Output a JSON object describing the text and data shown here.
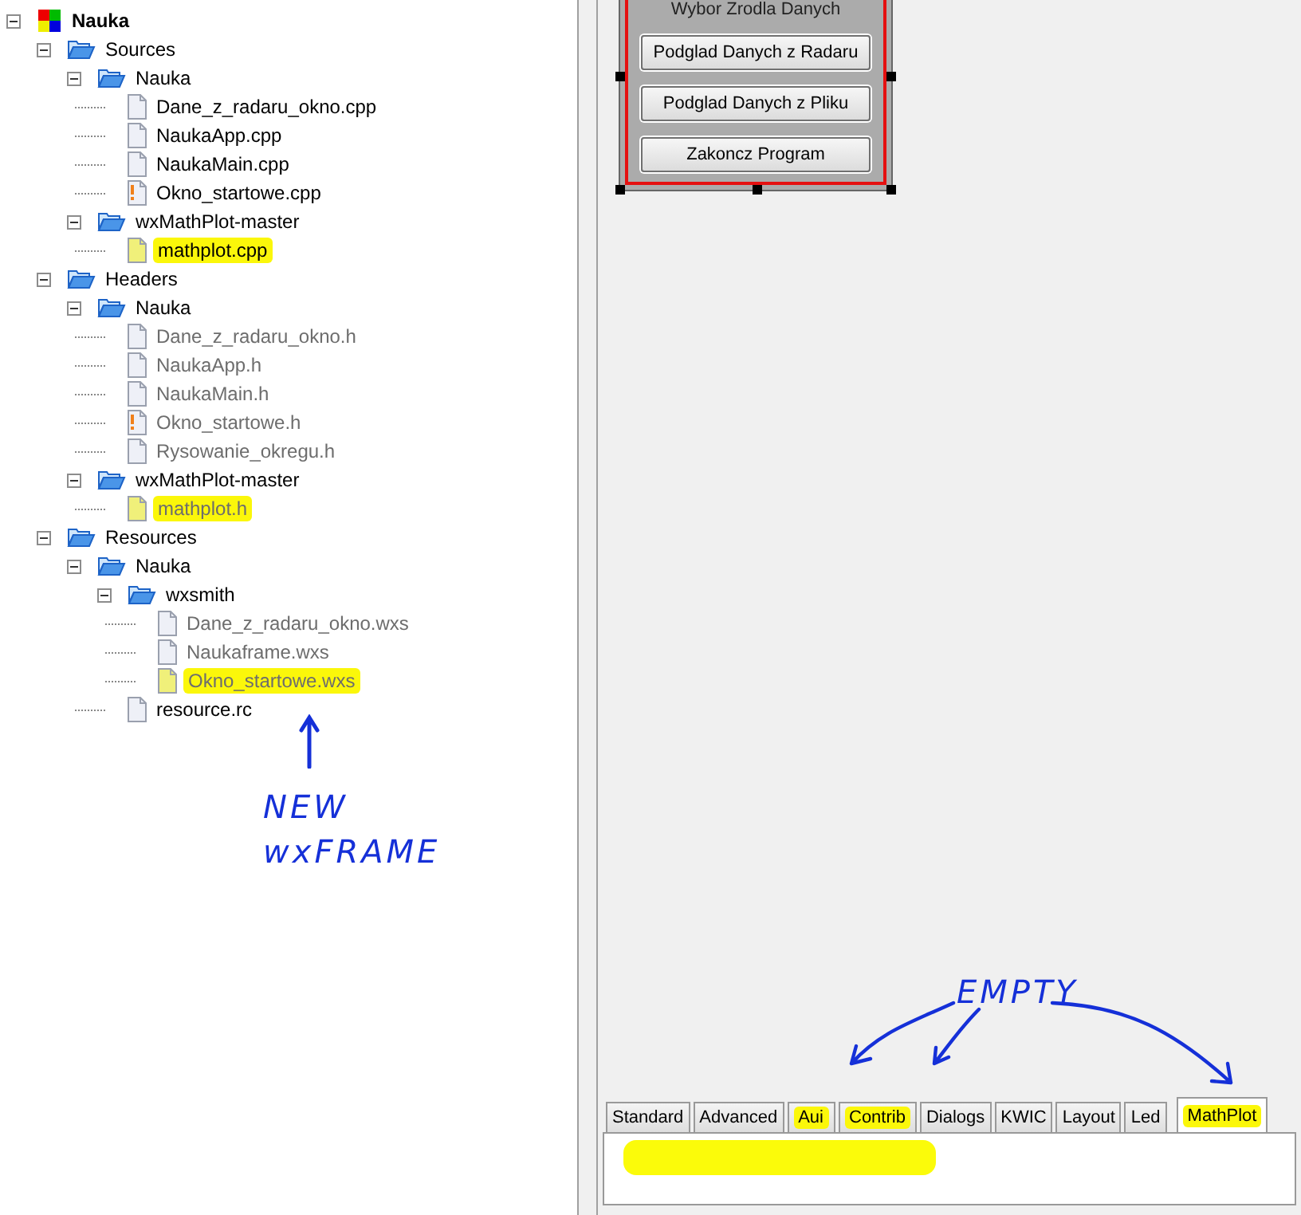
{
  "project_tree": [
    {
      "label": "Nauka",
      "kind": "project",
      "expanded": true,
      "dimmed": false,
      "highlighted": false,
      "children": [
        {
          "label": "Sources",
          "kind": "folder",
          "expanded": true,
          "dimmed": false,
          "highlighted": false,
          "children": [
            {
              "label": "Nauka",
              "kind": "folder",
              "expanded": true,
              "dimmed": false,
              "highlighted": false,
              "children": [
                {
                  "label": "Dane_z_radaru_okno.cpp",
                  "kind": "file",
                  "dimmed": false,
                  "highlighted": false
                },
                {
                  "label": "NaukaApp.cpp",
                  "kind": "file",
                  "dimmed": false,
                  "highlighted": false
                },
                {
                  "label": "NaukaMain.cpp",
                  "kind": "file",
                  "dimmed": false,
                  "highlighted": false
                },
                {
                  "label": "Okno_startowe.cpp",
                  "kind": "file-modified",
                  "dimmed": false,
                  "highlighted": false
                }
              ]
            },
            {
              "label": "wxMathPlot-master",
              "kind": "folder",
              "expanded": true,
              "dimmed": false,
              "highlighted": false,
              "children": [
                {
                  "label": "mathplot.cpp",
                  "kind": "file",
                  "dimmed": false,
                  "highlighted": true
                }
              ]
            }
          ]
        },
        {
          "label": "Headers",
          "kind": "folder",
          "expanded": true,
          "dimmed": false,
          "highlighted": false,
          "children": [
            {
              "label": "Nauka",
              "kind": "folder",
              "expanded": true,
              "dimmed": false,
              "highlighted": false,
              "children": [
                {
                  "label": "Dane_z_radaru_okno.h",
                  "kind": "file",
                  "dimmed": true,
                  "highlighted": false
                },
                {
                  "label": "NaukaApp.h",
                  "kind": "file",
                  "dimmed": true,
                  "highlighted": false
                },
                {
                  "label": "NaukaMain.h",
                  "kind": "file",
                  "dimmed": true,
                  "highlighted": false
                },
                {
                  "label": "Okno_startowe.h",
                  "kind": "file-modified",
                  "dimmed": true,
                  "highlighted": false
                },
                {
                  "label": "Rysowanie_okregu.h",
                  "kind": "file",
                  "dimmed": true,
                  "highlighted": false
                }
              ]
            },
            {
              "label": "wxMathPlot-master",
              "kind": "folder",
              "expanded": true,
              "dimmed": false,
              "highlighted": false,
              "children": [
                {
                  "label": "mathplot.h",
                  "kind": "file",
                  "dimmed": true,
                  "highlighted": true
                }
              ]
            }
          ]
        },
        {
          "label": "Resources",
          "kind": "folder",
          "expanded": true,
          "dimmed": false,
          "highlighted": false,
          "children": [
            {
              "label": "Nauka",
              "kind": "folder",
              "expanded": true,
              "dimmed": false,
              "highlighted": false,
              "children": [
                {
                  "label": "wxsmith",
                  "kind": "folder",
                  "expanded": true,
                  "dimmed": false,
                  "highlighted": false,
                  "children": [
                    {
                      "label": "Dane_z_radaru_okno.wxs",
                      "kind": "file",
                      "dimmed": true,
                      "highlighted": false
                    },
                    {
                      "label": "Naukaframe.wxs",
                      "kind": "file",
                      "dimmed": true,
                      "highlighted": false
                    },
                    {
                      "label": "Okno_startowe.wxs",
                      "kind": "file",
                      "dimmed": true,
                      "highlighted": true
                    }
                  ]
                },
                {
                  "label": "resource.rc",
                  "kind": "file",
                  "dimmed": false,
                  "highlighted": false
                }
              ]
            }
          ]
        }
      ]
    }
  ],
  "designer": {
    "group_label": "Wybor Zrodla Danych",
    "buttons": [
      "Podglad Danych z Radaru",
      "Podglad Danych z Pliku",
      "Zakoncz Program"
    ]
  },
  "palette_tabs": [
    {
      "label": "Standard",
      "selected": false,
      "highlighted": false
    },
    {
      "label": "Advanced",
      "selected": false,
      "highlighted": false
    },
    {
      "label": "Aui",
      "selected": false,
      "highlighted": true
    },
    {
      "label": "Contrib",
      "selected": false,
      "highlighted": true
    },
    {
      "label": "Dialogs",
      "selected": false,
      "highlighted": false
    },
    {
      "label": "KWIC",
      "selected": false,
      "highlighted": false
    },
    {
      "label": "Layout",
      "selected": false,
      "highlighted": false
    },
    {
      "label": "Led",
      "selected": false,
      "highlighted": false
    },
    {
      "label": "MathPlot",
      "selected": true,
      "highlighted": true
    }
  ],
  "annotations": {
    "new_note": [
      "NEW",
      "wxFRAME"
    ],
    "empty_note": "EMPTY"
  }
}
